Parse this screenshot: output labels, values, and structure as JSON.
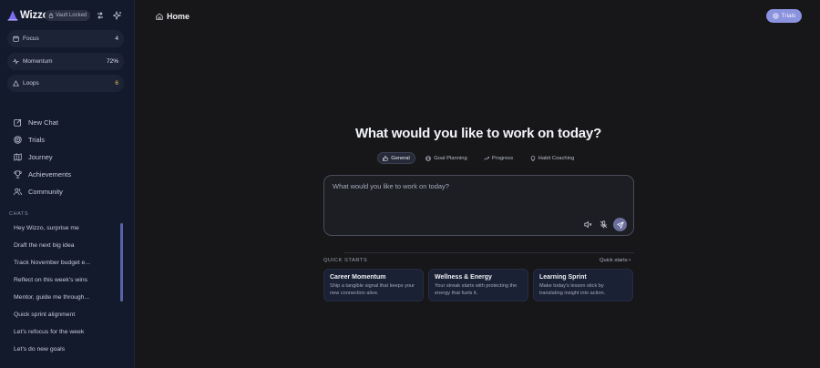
{
  "app": {
    "name": "Wizzo",
    "vault_badge": "Vault Locked"
  },
  "stats": [
    {
      "label": "Focus",
      "value": "4",
      "icon": "calendar-icon"
    },
    {
      "label": "Momentum",
      "value": "72%",
      "icon": "pulse-icon"
    },
    {
      "label": "Loops",
      "value": "6",
      "icon": "triangle-icon",
      "value_color": "#e8c94a"
    }
  ],
  "nav": [
    {
      "label": "New Chat",
      "icon": "edit-icon"
    },
    {
      "label": "Trials",
      "icon": "target-icon"
    },
    {
      "label": "Journey",
      "icon": "map-icon"
    },
    {
      "label": "Achievements",
      "icon": "trophy-icon"
    },
    {
      "label": "Community",
      "icon": "users-icon"
    }
  ],
  "chats": {
    "heading": "CHATS",
    "items": [
      "Hey Wizzo, surprise me",
      "Draft the next big idea",
      "Track November budget e...",
      "Reflect on this week's wins",
      "Mentor, guide me through...",
      "Quick sprint alignment",
      "Let's refocus for the week",
      "Let's do new goals"
    ]
  },
  "header": {
    "title": "Home",
    "trials_label": "Trials"
  },
  "hero": {
    "title": "What would you like to work on today?"
  },
  "modes": [
    {
      "label": "General",
      "icon": "thumb-icon",
      "active": true
    },
    {
      "label": "Goal Planning",
      "icon": "globe-icon",
      "active": false
    },
    {
      "label": "Progress",
      "icon": "trend-icon",
      "active": false
    },
    {
      "label": "Habit Coaching",
      "icon": "bulb-icon",
      "active": false
    }
  ],
  "prompt": {
    "placeholder": "What would you like to work on today?"
  },
  "quick_starts": {
    "heading": "QUICK STARTS",
    "link": "Quick starts •",
    "cards": [
      {
        "title": "Career Momentum",
        "desc": "Ship a tangible signal that keeps your new connection alive."
      },
      {
        "title": "Wellness & Energy",
        "desc": "Your streak starts with protecting the energy that fuels it."
      },
      {
        "title": "Learning Sprint",
        "desc": "Make today's lesson stick by translating insight into action."
      }
    ]
  },
  "colors": {
    "accent": "#8b92de",
    "sidebar_bg": "#131a2c",
    "main_bg": "#17171a"
  }
}
